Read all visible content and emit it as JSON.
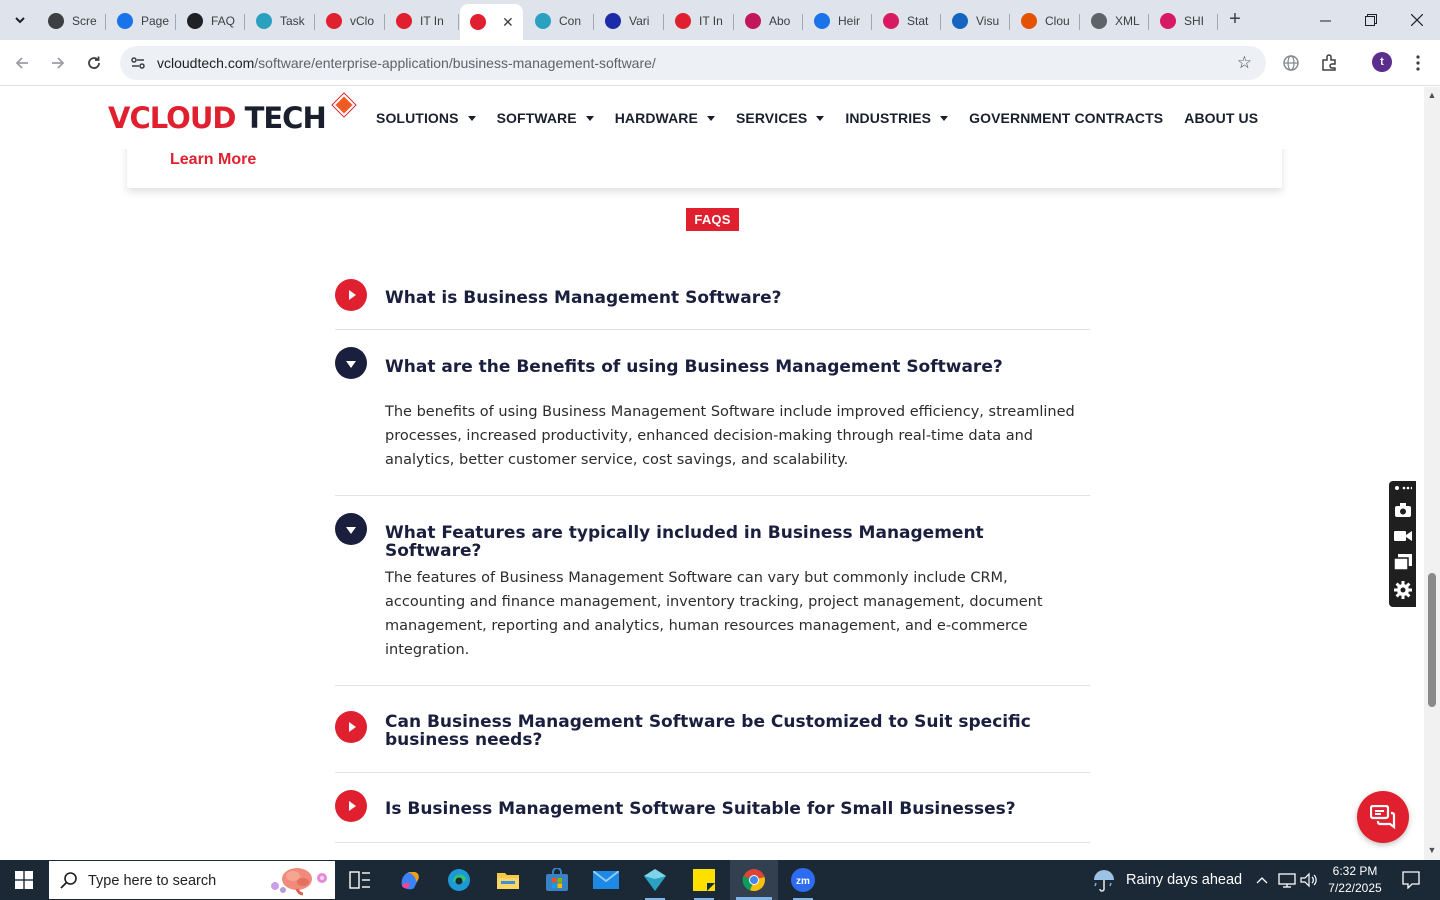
{
  "browser": {
    "tabs": [
      {
        "label": "Scre",
        "icon": "screencast-icon",
        "color": "#3c4043"
      },
      {
        "label": "Page",
        "icon": "pagespeed-icon",
        "color": "#1a73e8"
      },
      {
        "label": "FAQ",
        "icon": "openai-icon",
        "color": "#202124"
      },
      {
        "label": "Task",
        "icon": "clickup-icon",
        "color": "#2aa1c0"
      },
      {
        "label": "vClo",
        "icon": "vcloud-icon",
        "color": "#e0202e"
      },
      {
        "label": "IT In",
        "icon": "vcloud-diamond-icon",
        "color": "#e0202e"
      },
      {
        "label": "",
        "icon": "vcloud-diamond-icon",
        "color": "#e0202e",
        "active": true
      },
      {
        "label": "Con",
        "icon": "clickup-icon",
        "color": "#2aa1c0"
      },
      {
        "label": "Vari",
        "icon": "x-brand-icon",
        "color": "#1a2ca8"
      },
      {
        "label": "IT In",
        "icon": "vcloud-diamond-icon",
        "color": "#e0202e"
      },
      {
        "label": "Abo",
        "icon": "vcloud-diamond-icon",
        "color": "#c2185b"
      },
      {
        "label": "Heir",
        "icon": "scale-icon",
        "color": "#1a73e8"
      },
      {
        "label": "Stat",
        "icon": "statcounter-icon",
        "color": "#d81b60"
      },
      {
        "label": "Visu",
        "icon": "pulse-icon",
        "color": "#1565c0"
      },
      {
        "label": "Clou",
        "icon": "cloud-brand-icon",
        "color": "#e65100"
      },
      {
        "label": "XML",
        "icon": "globe-icon",
        "color": "#5f6368"
      },
      {
        "label": "SHI",
        "icon": "circle-brand-icon",
        "color": "#d81b60"
      }
    ],
    "url_host": "vcloudtech.com",
    "url_path": "/software/enterprise-application/business-management-software/",
    "profile_initial": "t"
  },
  "site": {
    "logo": {
      "v": "V",
      "cloud": "CLOUD",
      "tech": " TECH"
    },
    "nav": [
      {
        "label": "SOLUTIONS",
        "dropdown": true
      },
      {
        "label": "SOFTWARE",
        "dropdown": true
      },
      {
        "label": "HARDWARE",
        "dropdown": true
      },
      {
        "label": "SERVICES",
        "dropdown": true
      },
      {
        "label": "INDUSTRIES",
        "dropdown": true
      },
      {
        "label": "GOVERNMENT CONTRACTS",
        "dropdown": false
      },
      {
        "label": "ABOUT US",
        "dropdown": false
      }
    ],
    "learn_more": "Learn More",
    "faqs_badge": "FAQS",
    "faqs": [
      {
        "question": "What is Business Management Software?",
        "open": false,
        "answer": ""
      },
      {
        "question": "What are the Benefits of using Business Management Software?",
        "open": true,
        "answer": "The benefits of using Business Management Software include improved efficiency, streamlined processes, increased productivity, enhanced decision-making through real-time data and analytics, better customer service, cost savings, and scalability."
      },
      {
        "question": "What Features are typically included in Business Management Software?",
        "open": true,
        "answer": "The features of Business Management Software can vary but commonly include CRM, accounting and finance management, inventory tracking, project management, document management, reporting and analytics, human resources management, and e-commerce integration."
      },
      {
        "question": "Can Business Management Software be Customized to Suit specific business needs?",
        "open": false,
        "answer": ""
      },
      {
        "question": "Is Business Management Software Suitable for Small Businesses?",
        "open": false,
        "answer": ""
      }
    ],
    "brand_red": "#e0202e",
    "brand_navy": "#1a1f3e"
  },
  "taskbar": {
    "search_placeholder": "Type here to search",
    "weather": "Rainy days ahead",
    "time": "6:32 PM",
    "date": "7/22/2025"
  }
}
